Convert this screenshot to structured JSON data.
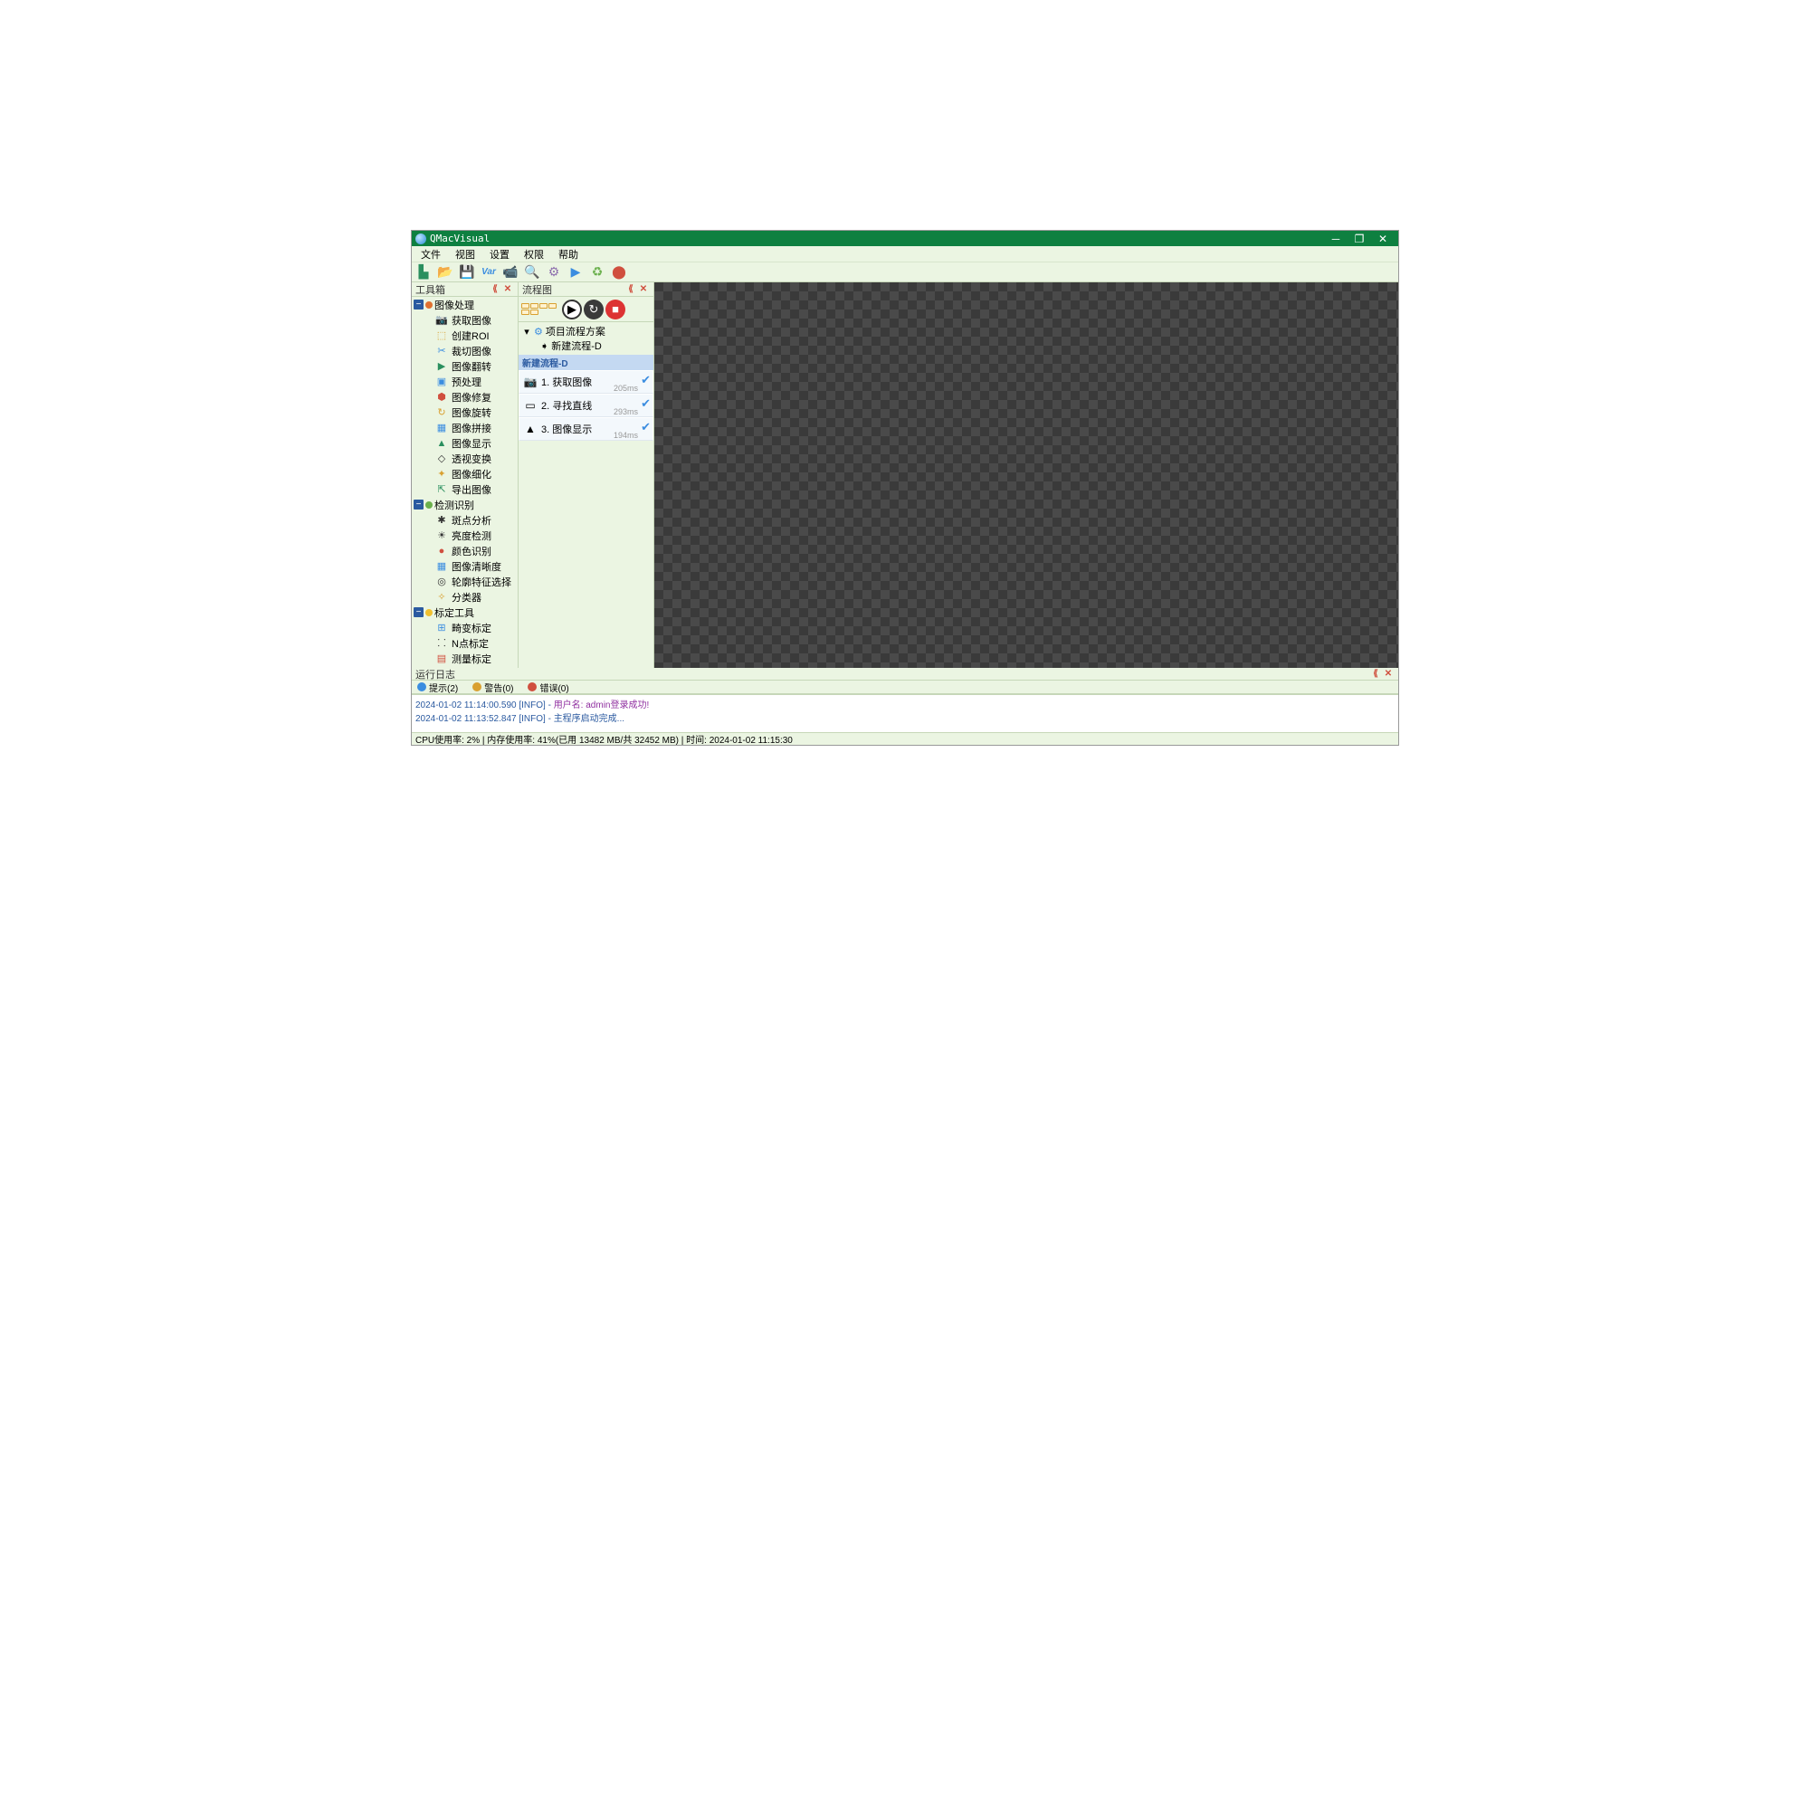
{
  "app_title": "QMacVisual",
  "menubar": [
    "文件",
    "视图",
    "设置",
    "权限",
    "帮助"
  ],
  "panels": {
    "toolbox_title": "工具箱",
    "flow_title": "流程图",
    "log_title": "运行日志"
  },
  "toolbox_categories": [
    {
      "label": "图像处理",
      "dot": "#e07030",
      "tools": [
        {
          "label": "获取图像",
          "icon": "📷",
          "color": "#d9a030"
        },
        {
          "label": "创建ROI",
          "icon": "⬚",
          "color": "#d9a030"
        },
        {
          "label": "裁切图像",
          "icon": "✂",
          "color": "#3b8de0"
        },
        {
          "label": "图像翻转",
          "icon": "▶",
          "color": "#2a8f5e"
        },
        {
          "label": "预处理",
          "icon": "▣",
          "color": "#3b8de0"
        },
        {
          "label": "图像修复",
          "icon": "⬢",
          "color": "#d04f3e"
        },
        {
          "label": "图像旋转",
          "icon": "↻",
          "color": "#d9a030"
        },
        {
          "label": "图像拼接",
          "icon": "▦",
          "color": "#3b8de0"
        },
        {
          "label": "图像显示",
          "icon": "▲",
          "color": "#2a8f5e"
        },
        {
          "label": "透视变换",
          "icon": "◇",
          "color": "#333"
        },
        {
          "label": "图像细化",
          "icon": "✦",
          "color": "#d9a030"
        },
        {
          "label": "导出图像",
          "icon": "⇱",
          "color": "#2a8f5e"
        }
      ]
    },
    {
      "label": "检测识别",
      "dot": "#6ab04c",
      "tools": [
        {
          "label": "斑点分析",
          "icon": "✱",
          "color": "#333"
        },
        {
          "label": "亮度检测",
          "icon": "☀",
          "color": "#333"
        },
        {
          "label": "颜色识别",
          "icon": "●",
          "color": "#d04f3e"
        },
        {
          "label": "图像清晰度",
          "icon": "▦",
          "color": "#3b8de0"
        },
        {
          "label": "轮廓特征选择",
          "icon": "◎",
          "color": "#333"
        },
        {
          "label": "分类器",
          "icon": "✧",
          "color": "#d9a030"
        }
      ]
    },
    {
      "label": "标定工具",
      "dot": "#f0c030",
      "tools": [
        {
          "label": "畸变标定",
          "icon": "⊞",
          "color": "#3b8de0"
        },
        {
          "label": "N点标定",
          "icon": "⸬",
          "color": "#333"
        },
        {
          "label": "测量标定",
          "icon": "▤",
          "color": "#d04f3e"
        }
      ]
    }
  ],
  "flow_tree": {
    "root_label": "项目流程方案",
    "child_label": "新建流程-D"
  },
  "flow_section": "新建流程-D",
  "flow_steps": [
    {
      "num": "1.",
      "label": "获取图像",
      "time": "205ms",
      "icon": "📷"
    },
    {
      "num": "2.",
      "label": "寻找直线",
      "time": "293ms",
      "icon": "▭"
    },
    {
      "num": "3.",
      "label": "图像显示",
      "time": "194ms",
      "icon": "▲"
    }
  ],
  "log_tabs": [
    {
      "label": "提示(2)",
      "color": "#3b8de0"
    },
    {
      "label": "警告(0)",
      "color": "#d9a030"
    },
    {
      "label": "错误(0)",
      "color": "#d04f3e"
    }
  ],
  "log_lines": [
    {
      "ts": "2024-01-02 11:14:00.590 [INFO]   -  ",
      "msg": "用户名: admin登录成功!",
      "cls": "log-msg1"
    },
    {
      "ts": "2024-01-02 11:13:52.847 [INFO]   -  ",
      "msg": "主程序启动完成...",
      "cls": "log-msg2"
    }
  ],
  "statusbar": "CPU使用率: 2%  |  内存使用率: 41%(已用 13482 MB/共 32452 MB)  |  时间: 2024-01-02 11:15:30"
}
